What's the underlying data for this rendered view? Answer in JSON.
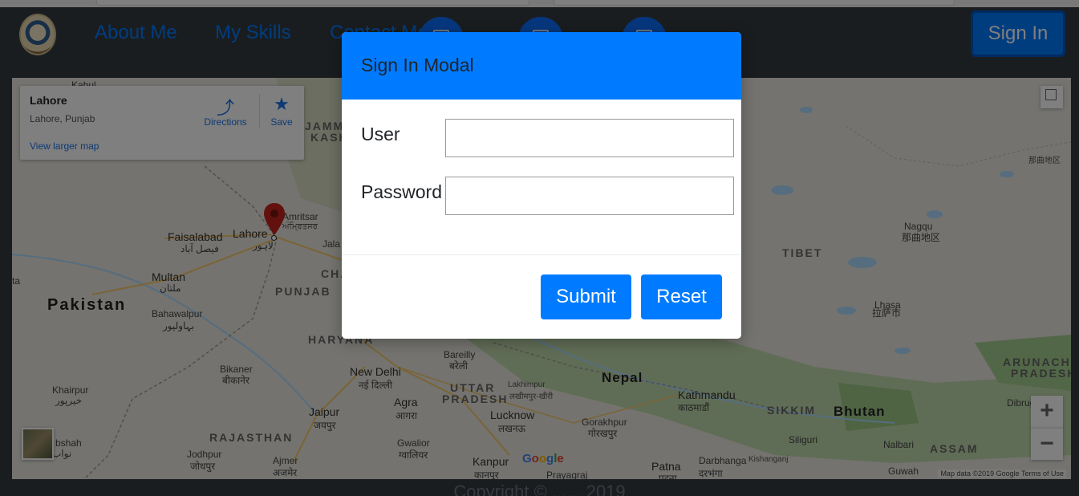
{
  "navbar": {
    "links": [
      "About Me",
      "My Skills",
      "Contact Me"
    ],
    "signin_label": "Sign In"
  },
  "map": {
    "info_card": {
      "place": "Lahore",
      "address": "Lahore, Punjab",
      "larger_map": "View larger map",
      "directions": "Directions",
      "save": "Save"
    },
    "labels": {
      "kabul": "Kabul",
      "jammu": "JAMMU",
      "kash": "KASH",
      "amritsar": "Amritsar",
      "amritsar_local": "ਅੰਮ੍ਰਿਤਸਰ",
      "faisalabad": "Faisalabad",
      "faisalabad_local": "فیصل آباد",
      "lahore": "Lahore",
      "lahore_local": "لاہور",
      "jala": "Jala",
      "multan": "Multan",
      "multan_local": "ملتان",
      "pakistan": "Pakistan",
      "bahawalpur": "Bahawalpur",
      "bahawalpur_local": "بہاولپور",
      "punjab": "PUNJAB",
      "cha": "CHA",
      "haryana": "HARYANA",
      "bikaner": "Bikaner",
      "bikaner_local": "बीकानेर",
      "new_delhi": "New Delhi",
      "new_delhi_local": "नई दिल्ली",
      "bareilly": "Bareilly",
      "bareilly_local": "बरेली",
      "uttar": "UTTAR",
      "pradesh": "PRADESH",
      "lakhimpur": "Lakhimpur",
      "lakhimpur_local": "लखीमपुर-खीरी",
      "nepal": "Nepal",
      "kathmandu": "Kathmandu",
      "kathmandu_local": "काठमाडौं",
      "khairpur": "Khairpur",
      "khairpur_local": "خیرپور",
      "jaipur": "Jaipur",
      "jaipur_local": "जयपुर",
      "agra": "Agra",
      "agra_local": "आगरा",
      "lucknow": "Lucknow",
      "lucknow_local": "लखनऊ",
      "gorakhpur": "Gorakhpur",
      "gorakhpur_local": "गोरखपुर",
      "sikkim": "SIKKIM",
      "bhutan": "Bhutan",
      "rajasthan": "RAJASTHAN",
      "gwalior": "Gwalior",
      "gwalior_local": "ग्वालियर",
      "nawabshah": "bshah",
      "nawabshah_local": "نواب",
      "jodhpur": "Jodhpur",
      "jodhpur_local": "जोधपुर",
      "ajmer": "Ajmer",
      "ajmer_local": "अजमेर",
      "kanpur": "Kanpur",
      "kanpur_local": "कानपुर",
      "prayagraj": "Prayagraj",
      "patna": "Patna",
      "patna_local": "पटना",
      "darbhanga": "Darbhanga",
      "darbhanga_local": "दरभंगा",
      "kishanganj": "Kishanganj",
      "siliguri": "Siliguri",
      "nalbari": "Nalbari",
      "assam": "ASSAM",
      "guwahati": "Guwah",
      "dibrug": "Dibrug",
      "arunachal": "ARUNACHAL",
      "arunachal_pradesh": "PRADESH",
      "tibet": "TIBET",
      "lhasa": "Lhasa",
      "lhasa_local": "拉萨市",
      "nagqu": "Nagqu",
      "nagqu_local": "那曲地区",
      "nagqu_region": "那曲地区",
      "ta": "ta"
    },
    "zoom_in": "+",
    "zoom_out": "−",
    "google": "Google",
    "attribution": "Map data ©2019 Google    Terms of Use"
  },
  "footer": {
    "text": "Copyright © ...... 2019"
  },
  "modal": {
    "title": "Sign In Modal",
    "user_label": "User",
    "user_value": "",
    "password_label": "Password",
    "password_value": "",
    "submit_label": "Submit",
    "reset_label": "Reset"
  },
  "colors": {
    "primary": "#007bff",
    "navbar": "#343a40",
    "map_land": "#e8e6df",
    "water": "#aadaff",
    "green": "#b7d7a0"
  }
}
